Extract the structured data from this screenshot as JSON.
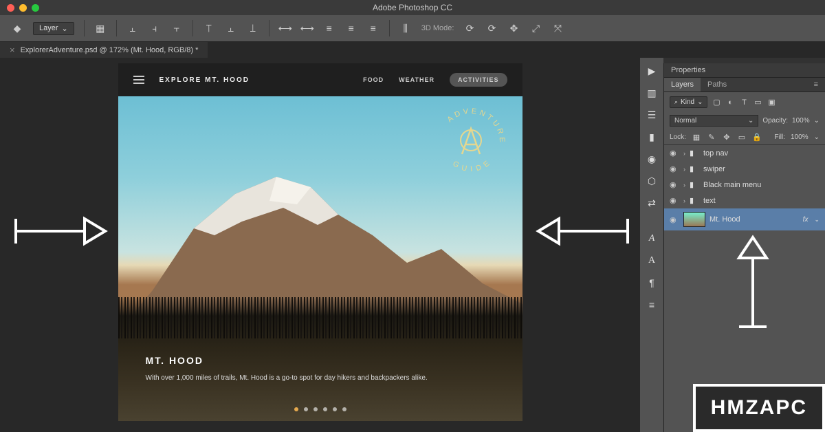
{
  "app_title": "Adobe Photoshop CC",
  "options_bar": {
    "layer_label": "Layer",
    "mode_label": "3D Mode:"
  },
  "doc_tab": "ExplorerAdventure.psd @ 172% (Mt. Hood, RGB/8) *",
  "canvas": {
    "site_title": "EXPLORE MT. HOOD",
    "nav": [
      "FOOD",
      "WEATHER",
      "ACTIVITIES"
    ],
    "badge_top": "ADVENTURE",
    "badge_bottom": "GUIDE",
    "hero_title": "MT. HOOD",
    "hero_sub": "With over 1,000 miles of trails, Mt. Hood is a go-to spot for day hikers and backpackers alike."
  },
  "panels": {
    "properties_label": "Properties",
    "layers_tab": "Layers",
    "paths_tab": "Paths",
    "kind_filter": "Kind",
    "blend_mode": "Normal",
    "opacity_label": "Opacity:",
    "opacity_value": "100%",
    "lock_label": "Lock:",
    "fill_label": "Fill:",
    "fill_value": "100%",
    "layers": [
      {
        "name": "top nav"
      },
      {
        "name": "swiper"
      },
      {
        "name": "Black main menu"
      },
      {
        "name": "text"
      },
      {
        "name": "Mt. Hood",
        "selected": true,
        "has_fx": true
      }
    ],
    "fx_label": "fx"
  },
  "watermark": "HMZAPC"
}
